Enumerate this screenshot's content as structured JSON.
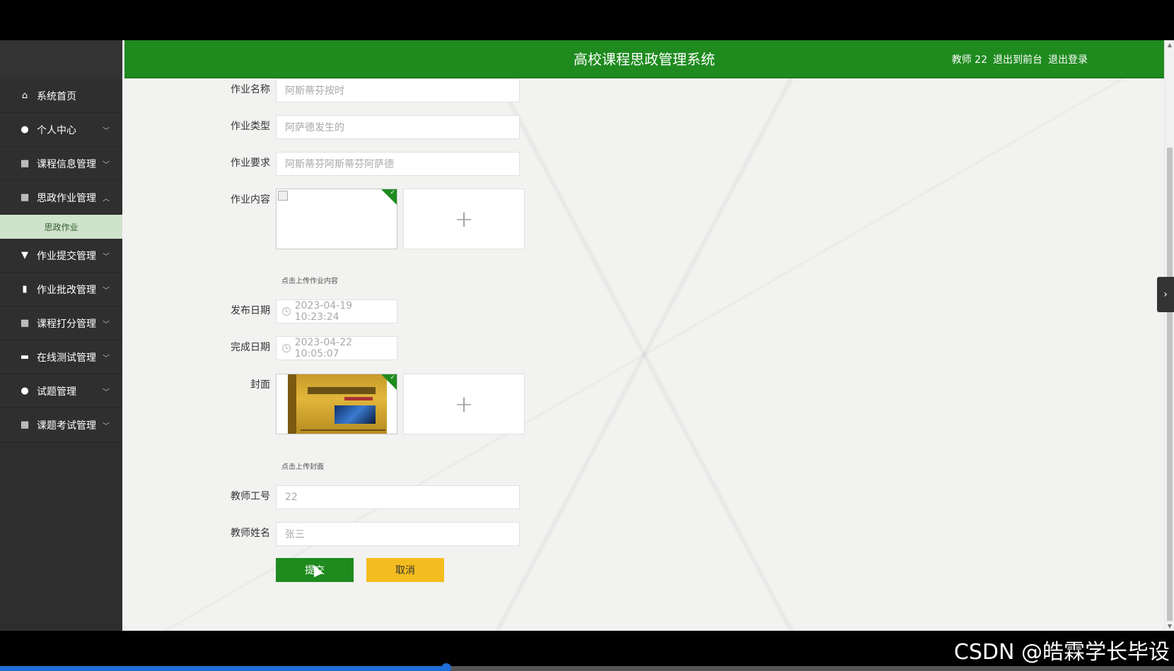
{
  "app": {
    "title": "高校课程思政管理系统"
  },
  "header": {
    "user": "教师 22",
    "to_front": "退出到前台",
    "logout": "退出登录"
  },
  "sidebar": {
    "items": [
      {
        "label": "系统首页",
        "icon": "home-icon"
      },
      {
        "label": "个人中心",
        "icon": "user-icon"
      },
      {
        "label": "课程信息管理",
        "icon": "grid-icon"
      },
      {
        "label": "思政作业管理",
        "icon": "grid-icon",
        "expanded": true
      },
      {
        "label": "作业提交管理",
        "icon": "pin-icon"
      },
      {
        "label": "作业批改管理",
        "icon": "book-icon"
      },
      {
        "label": "课程打分管理",
        "icon": "grid-icon"
      },
      {
        "label": "在线测试管理",
        "icon": "briefcase-icon"
      },
      {
        "label": "试题管理",
        "icon": "user-icon"
      },
      {
        "label": "课题考试管理",
        "icon": "grid-icon"
      }
    ],
    "submenu": {
      "label": "思政作业"
    }
  },
  "form": {
    "name": {
      "label": "作业名称",
      "value": "阿斯蒂芬按时"
    },
    "type": {
      "label": "作业类型",
      "value": "阿萨德发生的"
    },
    "requirement": {
      "label": "作业要求",
      "value": "阿斯蒂芬阿斯蒂芬阿萨德"
    },
    "content": {
      "label": "作业内容",
      "hint": "点击上传作业内容"
    },
    "publish_date": {
      "label": "发布日期",
      "value": "2023-04-19 10:23:24"
    },
    "finish_date": {
      "label": "完成日期",
      "value": "2023-04-22 10:05:07"
    },
    "cover": {
      "label": "封面",
      "hint": "点击上传封面"
    },
    "teacher_id": {
      "label": "教师工号",
      "value": "22"
    },
    "teacher_name": {
      "label": "教师姓名",
      "value": "张三"
    },
    "submit": "提交",
    "cancel": "取消"
  },
  "colors": {
    "primary": "#1f8b1f",
    "cancel": "#f4bd1f",
    "sidebar": "#2e2e2e"
  },
  "watermark": "CSDN @皓霖学长毕设",
  "video_progress": 0.38
}
